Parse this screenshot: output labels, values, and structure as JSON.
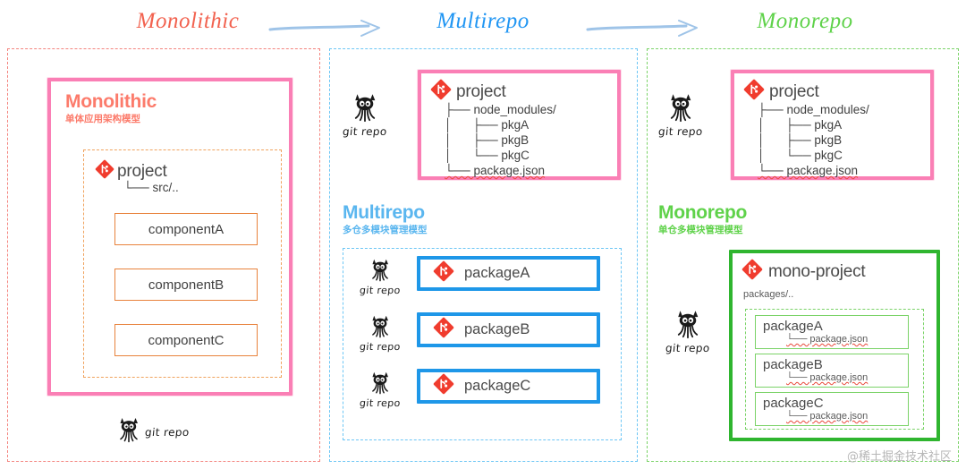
{
  "headers": {
    "monolithic": "Monolithic",
    "multirepo": "Multirepo",
    "monorepo": "Monorepo",
    "arrow_icon": "arrow-right-icon"
  },
  "colors": {
    "monolithic": "#f2624f",
    "multirepo": "#2196f3",
    "monorepo": "#5fd24a",
    "pink_box": "#fa7fb5",
    "blue_box": "#1e97e8",
    "green_box": "#2fb52f",
    "orange_box": "#e8823c",
    "git_logo": "#f03c2e"
  },
  "git_repo_label": "git repo",
  "columns": {
    "monolithic": {
      "title": "Monolithic",
      "subtitle": "单体应用架构模型",
      "project_name": "project",
      "tree_line": "└── src/..",
      "components": [
        "componentA",
        "componentB",
        "componentC"
      ],
      "git_repo": "git repo"
    },
    "multirepo": {
      "title": "Multirepo",
      "subtitle": "多仓多模块管理模型",
      "project": {
        "name": "project",
        "tree": [
          "├── node_modules/",
          "│      ├── pkgA",
          "│      ├── pkgB",
          "│      └── pkgC",
          "└── package.json"
        ],
        "git_repo": "git repo"
      },
      "packages": [
        {
          "name": "packageA",
          "git_repo": "git repo"
        },
        {
          "name": "packageB",
          "git_repo": "git repo"
        },
        {
          "name": "packageC",
          "git_repo": "git repo"
        }
      ]
    },
    "monorepo": {
      "title": "Monorepo",
      "subtitle": "单仓多模块管理模型",
      "project": {
        "name": "project",
        "tree": [
          "├── node_modules/",
          "│      ├── pkgA",
          "│      ├── pkgB",
          "│      └── pkgC",
          "└── package.json"
        ],
        "git_repo": "git repo"
      },
      "mono_project": {
        "name": "mono-project",
        "packages_dir": "packages/..",
        "git_repo": "git repo",
        "packages": [
          {
            "name": "packageA",
            "file": "└── package.json"
          },
          {
            "name": "packageB",
            "file": "└── package.json"
          },
          {
            "name": "packageC",
            "file": "└── package.json"
          }
        ]
      }
    }
  },
  "watermark": "@稀土掘金技术社区"
}
